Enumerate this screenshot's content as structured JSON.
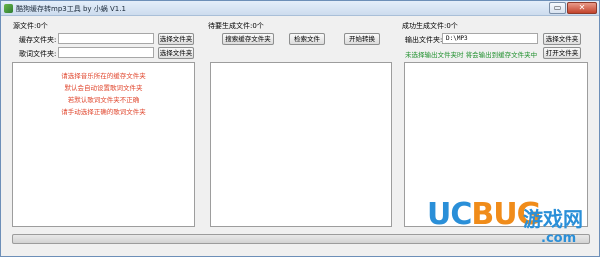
{
  "window": {
    "title": "酷狗缓存转mp3工具 by 小蜗 V1.1",
    "minimize_glyph": "▭",
    "close_glyph": "✕"
  },
  "left": {
    "source_count_label": "源文件:0个",
    "cache_folder_label": "缓存文件夹:",
    "cache_folder_value": "",
    "lyrics_folder_label": "歌词文件夹:",
    "lyrics_folder_value": "",
    "select_folder_label": "选择文件夹",
    "hints": [
      "请选择音乐所在的缓存文件夹",
      "默认会自动设置歌词文件夹",
      "若默认歌词文件夹不正确",
      "请手动选择正确的歌词文件夹"
    ]
  },
  "middle": {
    "pending_count_label": "待要生成文件:0个",
    "search_cache_folder_label": "搜索缓存文件夹",
    "search_files_label": "检索文件",
    "start_convert_label": "开始转换"
  },
  "right": {
    "success_count_label": "成功生成文件:0个",
    "output_folder_label": "输出文件夹:",
    "output_folder_value": "D:\\MP3",
    "select_folder_label": "选择文件夹",
    "open_folder_label": "打开文件夹",
    "hint": "未选择输出文件夹时 将会输出到缓存文件夹中"
  },
  "watermark": {
    "brand_part1": "UC",
    "brand_part2": "BUG",
    "brand_cn": "游戏网",
    "domain": ".com"
  },
  "colors": {
    "hint_red": "#e0462d",
    "hint_green": "#1e8f2c",
    "logo_blue": "#2a8fd8",
    "logo_orange": "#f08c1a"
  }
}
